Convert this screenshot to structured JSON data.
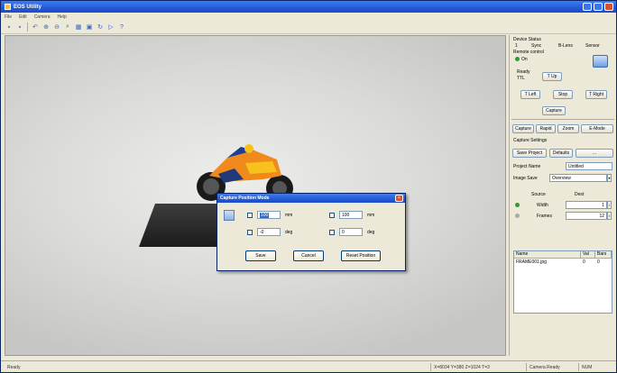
{
  "window": {
    "title": "EOS Utility"
  },
  "menu": [
    "File",
    "Edit",
    "Camera",
    "Help"
  ],
  "panel": {
    "status_label": "Device Status",
    "status_items": [
      "1",
      "Sync",
      "B-Lens",
      "Sensor"
    ],
    "control_label": "Remote control",
    "on_label": "On",
    "ready_label": "Ready",
    "ttl_label": "TTL",
    "btn_up": "T Up",
    "btn_left": "T Left",
    "btn_stop": "Stop",
    "btn_right": "T Right",
    "btn_capture": "Capture",
    "tabs": [
      "Capture",
      "Rapid",
      "Zoom",
      "E-Mode"
    ],
    "settings_label": "Capture Settings",
    "btn_save": "Save Project",
    "btn_defaults": "Defaults",
    "btn_more": "...",
    "project_label": "Project Name",
    "project_value": "Untitled",
    "folder_label": "Image Save",
    "folder_value": "Overview",
    "col_source": "Source",
    "col_dest": "Dest",
    "row1_label": "Width",
    "row1_value": "1",
    "row2_label": "Frames",
    "row2_value": "12",
    "list_cols": [
      "Name",
      "Val",
      "Bars"
    ],
    "list_rows": [
      {
        "name": "FRAME001.jpg",
        "val": "0",
        "bars": "0"
      }
    ]
  },
  "dialog": {
    "title": "Capture Position Mode",
    "x_value": "100",
    "x_unit": "mm",
    "x2_value": "100",
    "x2_unit": "mm",
    "a_value": "-0",
    "a_unit": "deg",
    "a2_value": "0",
    "a2_unit": "deg",
    "btn_save": "Save",
    "btn_cancel": "Cancel",
    "btn_reset": "Reset Position"
  },
  "status": {
    "left": "Ready",
    "coords": "X=8034 Y=380 Z=1024 T=3",
    "mode": "Camera Ready",
    "num": "NUM"
  },
  "icons": {
    "toolbar": [
      "save-icon",
      "open-icon",
      "undo-icon",
      "zoom-in-icon",
      "zoom-out-icon",
      "fit-icon",
      "grid-icon",
      "crop-icon",
      "rotate-icon",
      "play-icon",
      "help-icon"
    ]
  }
}
